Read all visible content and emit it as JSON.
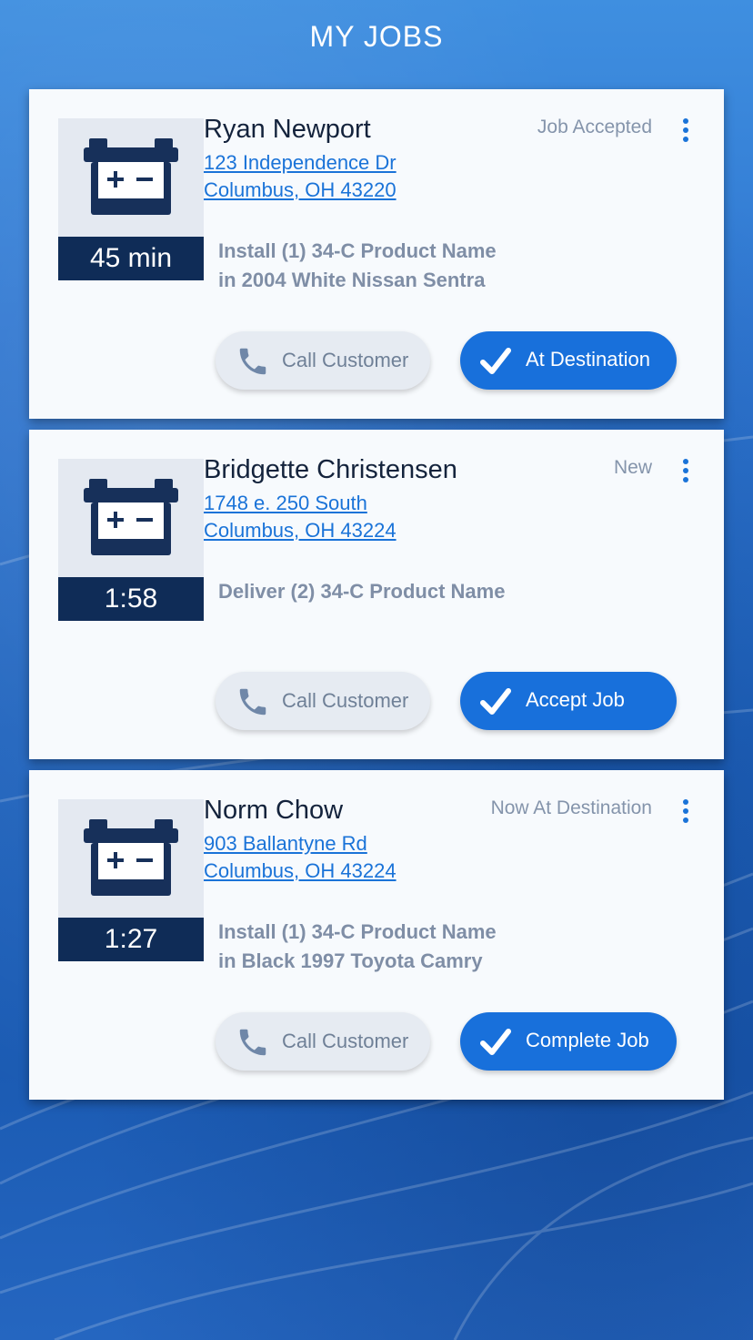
{
  "header": {
    "title": "MY JOBS"
  },
  "jobs": [
    {
      "name": "Ryan Newport",
      "address_line1": "123 Independence Dr",
      "address_line2": "Columbus, OH 43220",
      "status": "Job Accepted",
      "timer": "45 min",
      "desc_line1": "Install (1) 34-C Product Name",
      "desc_line2": "in 2004 White Nissan Sentra",
      "call_label": "Call Customer",
      "action_label": "At Destination"
    },
    {
      "name": "Bridgette Christensen",
      "address_line1": "1748 e. 250 South",
      "address_line2": "Columbus, OH 43224",
      "status": "New",
      "timer": "1:58",
      "desc_line1": "Deliver (2) 34-C Product Name",
      "desc_line2": "",
      "call_label": "Call Customer",
      "action_label": "Accept Job"
    },
    {
      "name": "Norm Chow",
      "address_line1": "903 Ballantyne Rd",
      "address_line2": "Columbus, OH 43224",
      "status": "Now At Destination",
      "timer": "1:27",
      "desc_line1": "Install (1) 34-C Product Name",
      "desc_line2": "in Black 1997 Toyota Camry",
      "call_label": "Call Customer",
      "action_label": "Complete Job"
    }
  ],
  "icons": {
    "job_thumbnail": "battery-icon",
    "call": "phone-icon",
    "action": "checkmark-icon",
    "menu": "more-vertical-icon"
  },
  "colors": {
    "accent": "#1870db",
    "timer_bg": "#0f2c57",
    "link": "#1a73d8"
  }
}
